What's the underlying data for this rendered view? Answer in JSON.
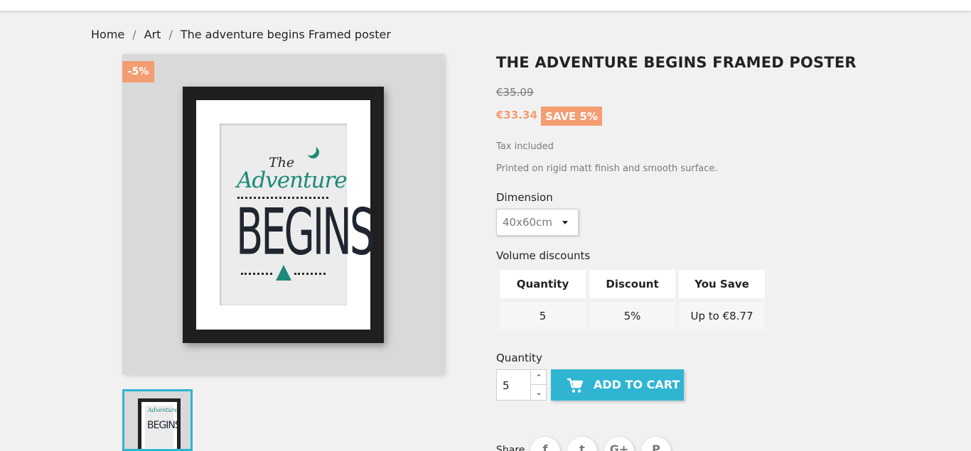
{
  "breadcrumb": {
    "items": [
      "Home",
      "Art",
      "The adventure begins Framed poster"
    ],
    "separator": "/"
  },
  "product": {
    "discount_badge": "-5%",
    "title": "THE ADVENTURE BEGINS FRAMED POSTER",
    "old_price": "€35.09",
    "price": "€33.34",
    "save_badge": "SAVE 5%",
    "tax_note": "Tax included",
    "description": "Printed on rigid matt finish and smooth surface.",
    "poster": {
      "line1": "The",
      "line2": "Adventure",
      "line3": "BEGINS"
    },
    "thumbnail": {
      "line2": "Adventure",
      "line3": "BEGINS"
    }
  },
  "dimension": {
    "label": "Dimension",
    "selected": "40x60cm"
  },
  "volume_discounts": {
    "label": "Volume discounts",
    "headers": [
      "Quantity",
      "Discount",
      "You Save"
    ],
    "rows": [
      [
        "5",
        "5%",
        "Up to €8.77"
      ]
    ]
  },
  "quantity": {
    "label": "Quantity",
    "value": "5",
    "up_glyph": "⌃",
    "down_glyph": "⌄"
  },
  "add_to_cart": {
    "label": "ADD TO CART"
  },
  "share": {
    "label": "Share",
    "icons": [
      "facebook-icon",
      "twitter-icon",
      "googleplus-icon",
      "pinterest-icon"
    ],
    "glyphs": [
      "f",
      "t",
      "G+",
      "P"
    ]
  },
  "colors": {
    "accent": "#2fb5d2",
    "discount": "#f39d72",
    "poster_green": "#1d8a78"
  }
}
